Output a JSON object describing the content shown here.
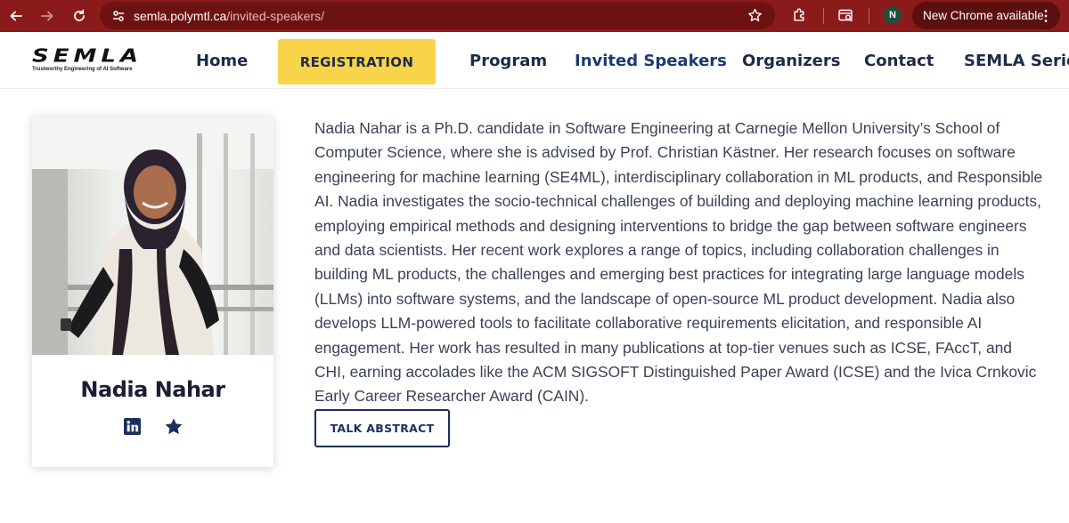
{
  "browser": {
    "url_host": "semla.polymtl.ca",
    "url_path": "/invited-speakers/",
    "profile_initial": "N",
    "update_label": "New Chrome available",
    "icons": [
      "back-arrow-icon",
      "forward-arrow-icon",
      "reload-icon",
      "site-settings-icon",
      "bookmark-star-icon",
      "extensions-icon",
      "tab-search-icon",
      "kebab-menu-icon"
    ]
  },
  "site": {
    "logo_text": "SEMLA",
    "logo_tagline": "Trustworthy Engineering of AI Software",
    "nav": {
      "home": "Home",
      "registration": "REGISTRATION",
      "program": "Program",
      "invited_speakers": "Invited Speakers",
      "organizers": "Organizers",
      "contact": "Contact",
      "semla_series": "SEMLA Series"
    }
  },
  "speaker": {
    "name": "Nadia Nahar",
    "bio": "Nadia Nahar is a Ph.D. candidate in Software Engineering at Carnegie Mellon University’s School of Computer Science, where she is advised by Prof. Christian Kästner. Her research focuses on software engineering for machine learning (SE4ML), interdisciplinary collaboration in ML products, and Responsible AI. Nadia investigates the socio-technical challenges of building and deploying machine learning products, employing empirical methods and designing interventions to bridge the gap between software engineers and data scientists. Her recent work explores a range of topics, including collaboration challenges in building ML products, the challenges and emerging best practices for integrating large language models (LLMs) into software systems, and the landscape of open-source ML product development. Nadia also develops LLM-powered tools to facilitate collaborative requirements elicitation, and responsible AI engagement. Her work has resulted in many publications at top-tier venues such as ICSE, FAccT, and CHI, earning accolades like the ACM SIGSOFT Distinguished Paper Award (ICSE) and the Ivica Crnkovic Early Career Researcher Award (CAIN).",
    "talk_button": "TALK ABSTRACT",
    "social_icons": [
      "linkedin-icon",
      "star-icon"
    ]
  },
  "colors": {
    "browser_bar": "#8b1a1a",
    "registration_bg": "#f8d44a",
    "nav_text": "#1e2a4a",
    "button_border": "#1c2f5e",
    "body_text": "#3b4256"
  }
}
